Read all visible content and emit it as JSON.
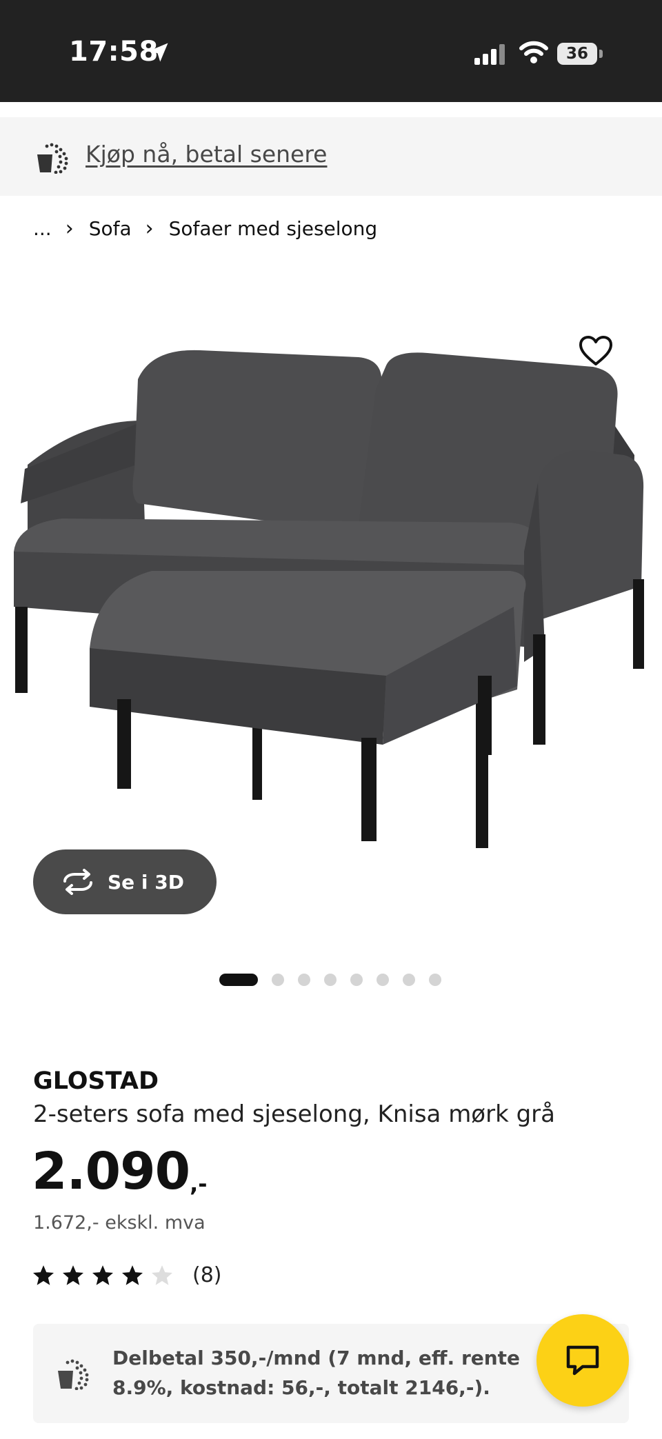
{
  "status_bar": {
    "time": "17:58",
    "battery": "36"
  },
  "promo": {
    "label": "Kjøp nå, betal senere"
  },
  "breadcrumb": {
    "items": [
      "...",
      "Sofa",
      "Sofaer med sjeselong"
    ]
  },
  "gallery": {
    "view_3d_label": "Se i 3D",
    "image_count": 8,
    "active_index": 0
  },
  "product": {
    "name": "GLOSTAD",
    "description": "2-seters sofa med sjeselong, Knisa mørk grå",
    "price_integer": "2.090",
    "price_suffix": ",-",
    "price_excl_vat": "1.672,- ekskl. mva",
    "rating_stars": 4,
    "rating_max": 5,
    "rating_count": "(8)"
  },
  "installment": {
    "text": "Delbetal 350,-/mnd (7 mnd, eff. rente 8.9%, kostnad: 56,-, totalt 2146,-)."
  },
  "colors": {
    "status_bg": "#222222",
    "banner_bg": "#f5f5f5",
    "chat_button": "#fcd116",
    "sofa_fabric": "#4b4b4d"
  },
  "icons": {
    "promo": "wallet-payment-icon",
    "favorite": "heart-icon",
    "rotate": "rotate-3d-icon",
    "chat": "chat-bubble-icon"
  }
}
